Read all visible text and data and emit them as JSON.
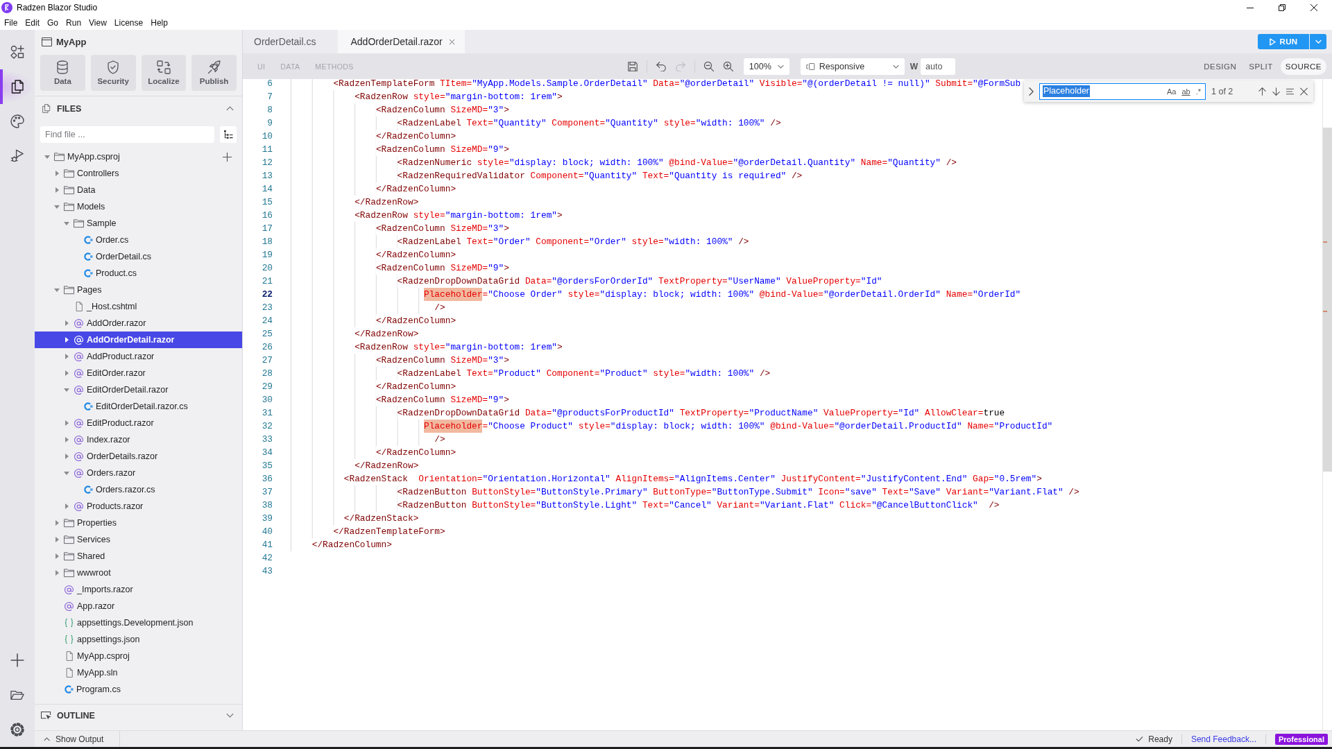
{
  "window": {
    "title": "Radzen Blazor Studio"
  },
  "menu": [
    "File",
    "Edit",
    "Go",
    "Run",
    "View",
    "License",
    "Help"
  ],
  "activity_bar": {
    "items": [
      {
        "selected": false
      },
      {
        "selected": true
      },
      {
        "selected": false
      },
      {
        "selected": false
      }
    ]
  },
  "sidebar": {
    "project": {
      "title": "MyApp"
    },
    "tiles": [
      {
        "label": "Data"
      },
      {
        "label": "Security"
      },
      {
        "label": "Localize"
      },
      {
        "label": "Publish"
      }
    ],
    "files": {
      "title": "FILES",
      "expanded": true,
      "search": {
        "placeholder": "Find file ..."
      },
      "tree": [
        {
          "kind": "folder",
          "label": "MyApp.csproj",
          "expanded": true,
          "selected": false,
          "children": [
            {
              "kind": "folder",
              "label": "Controllers",
              "expanded": false,
              "selected": false
            },
            {
              "kind": "folder",
              "label": "Data",
              "expanded": false,
              "selected": false
            },
            {
              "kind": "folder",
              "label": "Models",
              "expanded": true,
              "selected": false,
              "children": [
                {
                  "kind": "folder",
                  "label": "Sample",
                  "expanded": true,
                  "selected": false,
                  "children": [
                    {
                      "kind": "cs",
                      "label": "Order.cs",
                      "selected": false
                    },
                    {
                      "kind": "cs",
                      "label": "OrderDetail.cs",
                      "selected": false
                    },
                    {
                      "kind": "cs",
                      "label": "Product.cs",
                      "selected": false
                    }
                  ]
                }
              ]
            },
            {
              "kind": "folder",
              "label": "Pages",
              "expanded": true,
              "selected": false,
              "children": [
                {
                  "kind": "file",
                  "label": "_Host.cshtml",
                  "selected": false
                },
                {
                  "kind": "razor",
                  "label": "AddOrder.razor",
                  "expanded": false,
                  "selected": false
                },
                {
                  "kind": "razor",
                  "label": "AddOrderDetail.razor",
                  "expanded": false,
                  "selected": true
                },
                {
                  "kind": "razor",
                  "label": "AddProduct.razor",
                  "expanded": false,
                  "selected": false
                },
                {
                  "kind": "razor",
                  "label": "EditOrder.razor",
                  "expanded": false,
                  "selected": false
                },
                {
                  "kind": "razor",
                  "label": "EditOrderDetail.razor",
                  "expanded": true,
                  "selected": false,
                  "children": [
                    {
                      "kind": "cs",
                      "label": "EditOrderDetail.razor.cs",
                      "selected": false
                    }
                  ]
                },
                {
                  "kind": "razor",
                  "label": "EditProduct.razor",
                  "expanded": false,
                  "selected": false
                },
                {
                  "kind": "razor",
                  "label": "Index.razor",
                  "expanded": false,
                  "selected": false
                },
                {
                  "kind": "razor",
                  "label": "OrderDetails.razor",
                  "expanded": false,
                  "selected": false
                },
                {
                  "kind": "razor",
                  "label": "Orders.razor",
                  "expanded": true,
                  "selected": false,
                  "children": [
                    {
                      "kind": "cs",
                      "label": "Orders.razor.cs",
                      "selected": false
                    }
                  ]
                },
                {
                  "kind": "razor",
                  "label": "Products.razor",
                  "expanded": false,
                  "selected": false
                }
              ]
            },
            {
              "kind": "folder",
              "label": "Properties",
              "expanded": false,
              "selected": false
            },
            {
              "kind": "folder",
              "label": "Services",
              "expanded": false,
              "selected": false
            },
            {
              "kind": "folder",
              "label": "Shared",
              "expanded": false,
              "selected": false
            },
            {
              "kind": "folder",
              "label": "wwwroot",
              "expanded": false,
              "selected": false
            },
            {
              "kind": "razor",
              "label": "_Imports.razor",
              "selected": false
            },
            {
              "kind": "razor",
              "label": "App.razor",
              "selected": false
            },
            {
              "kind": "json",
              "label": "appsettings.Development.json",
              "selected": false
            },
            {
              "kind": "json",
              "label": "appsettings.json",
              "selected": false
            },
            {
              "kind": "file",
              "label": "MyApp.csproj",
              "selected": false
            },
            {
              "kind": "file",
              "label": "MyApp.sln",
              "selected": false
            },
            {
              "kind": "cs",
              "label": "Program.cs",
              "selected": false
            }
          ]
        }
      ]
    },
    "outline": {
      "title": "OUTLINE",
      "expanded": false
    }
  },
  "editor": {
    "tabs": [
      {
        "label": "OrderDetail.cs",
        "selected": false
      },
      {
        "label": "AddOrderDetail.razor",
        "selected": true
      }
    ],
    "run_button": {
      "label": "RUN"
    },
    "toolbar": {
      "views": [
        {
          "label": "UI",
          "disabled": true
        },
        {
          "label": "DATA",
          "disabled": true
        },
        {
          "label": "METHODS",
          "disabled": true
        }
      ],
      "undo": {
        "disabled": false
      },
      "redo": {
        "disabled": true
      },
      "zoom": {
        "value": "100%"
      },
      "device": {
        "value": "Responsive"
      },
      "width": {
        "label": "W",
        "value": "auto"
      },
      "modes": [
        {
          "label": "DESIGN",
          "selected": false
        },
        {
          "label": "SPLIT",
          "selected": false
        },
        {
          "label": "SOURCE",
          "selected": true
        }
      ]
    },
    "find": {
      "query": "Placeholder",
      "query_selected": true,
      "options": [
        {
          "label": "Aa",
          "on": false
        },
        {
          "label": "ab",
          "on": false
        },
        {
          "label": ".*",
          "on": false
        }
      ],
      "result": "1 of 2"
    },
    "lines": [
      {
        "number": "6",
        "current": false,
        "segments": [
          {
            "text": "        <RadzenTemplateForm TItem=\"MyApp.Models.Sample.OrderDetail\" Data=\"@orderDetail\" Visible=\"@(orderDetail != null)\" Submit=\"@FormSub",
            "match": false
          }
        ]
      },
      {
        "number": "7",
        "current": false,
        "segments": [
          {
            "text": "            <RadzenRow style=\"margin-bottom: 1rem\">",
            "match": false
          }
        ]
      },
      {
        "number": "8",
        "current": false,
        "segments": [
          {
            "text": "                <RadzenColumn SizeMD=\"3\">",
            "match": false
          }
        ]
      },
      {
        "number": "9",
        "current": false,
        "segments": [
          {
            "text": "                    <RadzenLabel Text=\"Quantity\" Component=\"Quantity\" style=\"width: 100%\" />",
            "match": false
          }
        ]
      },
      {
        "number": "10",
        "current": false,
        "segments": [
          {
            "text": "                </RadzenColumn>",
            "match": false
          }
        ]
      },
      {
        "number": "11",
        "current": false,
        "segments": [
          {
            "text": "                <RadzenColumn SizeMD=\"9\">",
            "match": false
          }
        ]
      },
      {
        "number": "12",
        "current": false,
        "segments": [
          {
            "text": "                    <RadzenNumeric style=\"display: block; width: 100%\" @bind-Value=\"@orderDetail.Quantity\" Name=\"Quantity\" />",
            "match": false
          }
        ]
      },
      {
        "number": "13",
        "current": false,
        "segments": [
          {
            "text": "                    <RadzenRequiredValidator Component=\"Quantity\" Text=\"Quantity is required\" />",
            "match": false
          }
        ]
      },
      {
        "number": "14",
        "current": false,
        "segments": [
          {
            "text": "                </RadzenColumn>",
            "match": false
          }
        ]
      },
      {
        "number": "15",
        "current": false,
        "segments": [
          {
            "text": "            </RadzenRow>",
            "match": false
          }
        ]
      },
      {
        "number": "16",
        "current": false,
        "segments": [
          {
            "text": "            <RadzenRow style=\"margin-bottom: 1rem\">",
            "match": false
          }
        ]
      },
      {
        "number": "17",
        "current": false,
        "segments": [
          {
            "text": "                <RadzenColumn SizeMD=\"3\">",
            "match": false
          }
        ]
      },
      {
        "number": "18",
        "current": false,
        "segments": [
          {
            "text": "                    <RadzenLabel Text=\"Order\" Component=\"Order\" style=\"width: 100%\" />",
            "match": false
          }
        ]
      },
      {
        "number": "19",
        "current": false,
        "segments": [
          {
            "text": "                </RadzenColumn>",
            "match": false
          }
        ]
      },
      {
        "number": "20",
        "current": false,
        "segments": [
          {
            "text": "                <RadzenColumn SizeMD=\"9\">",
            "match": false
          }
        ]
      },
      {
        "number": "21",
        "current": false,
        "segments": [
          {
            "text": "                    <RadzenDropDownDataGrid Data=\"@ordersForOrderId\" TextProperty=\"UserName\" ValueProperty=\"Id\"",
            "match": false
          }
        ]
      },
      {
        "number": "22",
        "current": true,
        "segments": [
          {
            "text": "                         Placeholder",
            "match": true
          },
          {
            "text": "=\"Choose Order\" style=\"display: block; width: 100%\" @bind-Value=\"@orderDetail.OrderId\" Name=\"OrderId\"",
            "match": false
          }
        ]
      },
      {
        "number": "23",
        "current": false,
        "segments": [
          {
            "text": "                           />",
            "match": false
          }
        ]
      },
      {
        "number": "24",
        "current": false,
        "segments": [
          {
            "text": "                </RadzenColumn>",
            "match": false
          }
        ]
      },
      {
        "number": "25",
        "current": false,
        "segments": [
          {
            "text": "            </RadzenRow>",
            "match": false
          }
        ]
      },
      {
        "number": "26",
        "current": false,
        "segments": [
          {
            "text": "            <RadzenRow style=\"margin-bottom: 1rem\">",
            "match": false
          }
        ]
      },
      {
        "number": "27",
        "current": false,
        "segments": [
          {
            "text": "                <RadzenColumn SizeMD=\"3\">",
            "match": false
          }
        ]
      },
      {
        "number": "28",
        "current": false,
        "segments": [
          {
            "text": "                    <RadzenLabel Text=\"Product\" Component=\"Product\" style=\"width: 100%\" />",
            "match": false
          }
        ]
      },
      {
        "number": "29",
        "current": false,
        "segments": [
          {
            "text": "                </RadzenColumn>",
            "match": false
          }
        ]
      },
      {
        "number": "30",
        "current": false,
        "segments": [
          {
            "text": "                <RadzenColumn SizeMD=\"9\">",
            "match": false
          }
        ]
      },
      {
        "number": "31",
        "current": false,
        "segments": [
          {
            "text": "                    <RadzenDropDownDataGrid Data=\"@productsForProductId\" TextProperty=\"ProductName\" ValueProperty=\"Id\" AllowClear=true",
            "match": false
          }
        ]
      },
      {
        "number": "32",
        "current": false,
        "segments": [
          {
            "text": "                         Placeholder",
            "match": true
          },
          {
            "text": "=\"Choose Product\" style=\"display: block; width: 100%\" @bind-Value=\"@orderDetail.ProductId\" Name=\"ProductId\"",
            "match": false
          }
        ]
      },
      {
        "number": "33",
        "current": false,
        "segments": [
          {
            "text": "                           />",
            "match": false
          }
        ]
      },
      {
        "number": "34",
        "current": false,
        "segments": [
          {
            "text": "                </RadzenColumn>",
            "match": false
          }
        ]
      },
      {
        "number": "35",
        "current": false,
        "segments": [
          {
            "text": "            </RadzenRow>",
            "match": false
          }
        ]
      },
      {
        "number": "36",
        "current": false,
        "segments": [
          {
            "text": "          <RadzenStack  Orientation=\"Orientation.Horizontal\" AlignItems=\"AlignItems.Center\" JustifyContent=\"JustifyContent.End\" Gap=\"0.5rem\">",
            "match": false
          }
        ]
      },
      {
        "number": "37",
        "current": false,
        "segments": [
          {
            "text": "                    <RadzenButton ButtonStyle=\"ButtonStyle.Primary\" ButtonType=\"ButtonType.Submit\" Icon=\"save\" Text=\"Save\" Variant=\"Variant.Flat\" />",
            "match": false
          }
        ]
      },
      {
        "number": "38",
        "current": false,
        "segments": [
          {
            "text": "                    <RadzenButton ButtonStyle=\"ButtonStyle.Light\" Text=\"Cancel\" Variant=\"Variant.Flat\" Click=\"@CancelButtonClick\"  />",
            "match": false
          }
        ]
      },
      {
        "number": "39",
        "current": false,
        "segments": [
          {
            "text": "          </RadzenStack>",
            "match": false
          }
        ]
      },
      {
        "number": "40",
        "current": false,
        "segments": [
          {
            "text": "        </RadzenTemplateForm>",
            "match": false
          }
        ]
      },
      {
        "number": "41",
        "current": false,
        "segments": [
          {
            "text": "    </RadzenColumn>",
            "match": false
          }
        ]
      },
      {
        "number": "42",
        "current": false
      },
      {
        "number": "43",
        "current": false
      }
    ]
  },
  "status_bar": {
    "output_toggle": "Show Output",
    "status": "Ready",
    "feedback_link": "Send Feedback...",
    "license": "Professional"
  }
}
